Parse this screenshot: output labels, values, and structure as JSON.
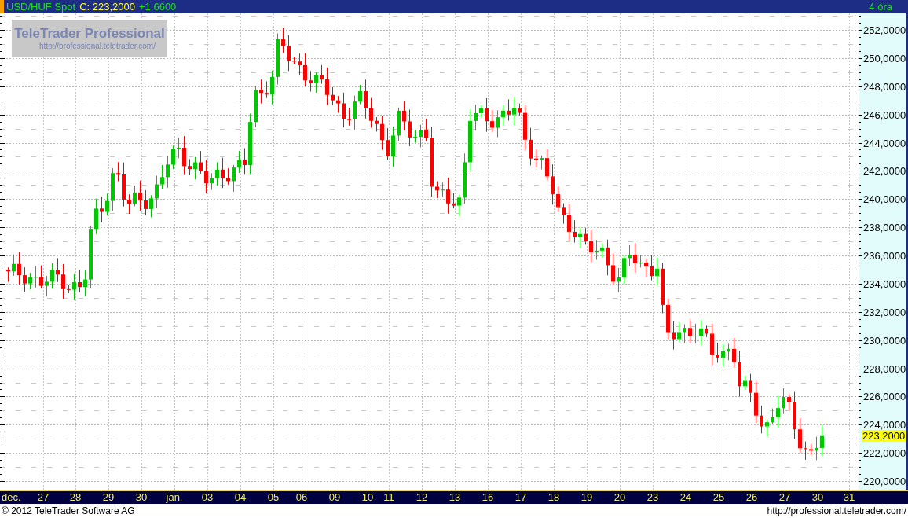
{
  "header": {
    "instrument": "USD/HUF Spot",
    "close": "C: 223,2000",
    "change": "+1,6600",
    "interval": "4 óra"
  },
  "logo": {
    "title": "TeleTrader Professional",
    "url": "http://professional.teletrader.com/"
  },
  "y_axis": {
    "labels": [
      "252,0000",
      "250,0000",
      "248,0000",
      "246,0000",
      "244,0000",
      "242,0000",
      "240,0000",
      "238,0000",
      "236,0000",
      "234,0000",
      "232,0000",
      "230,0000",
      "228,0000",
      "226,0000",
      "224,0000",
      "222,0000",
      "220,0000"
    ],
    "current_price": "223,2000"
  },
  "x_axis": {
    "labels": [
      "dec.",
      "27",
      "28",
      "29",
      "30",
      "jan.",
      "03",
      "04",
      "05",
      "06",
      "09",
      "10",
      "11",
      "12",
      "13",
      "16",
      "17",
      "18",
      "19",
      "20",
      "23",
      "24",
      "25",
      "26",
      "27",
      "30",
      "31"
    ]
  },
  "footer": {
    "copyright": "© 2012 TeleTrader Software AG",
    "url": "http://professional.teletrader.com/"
  }
}
